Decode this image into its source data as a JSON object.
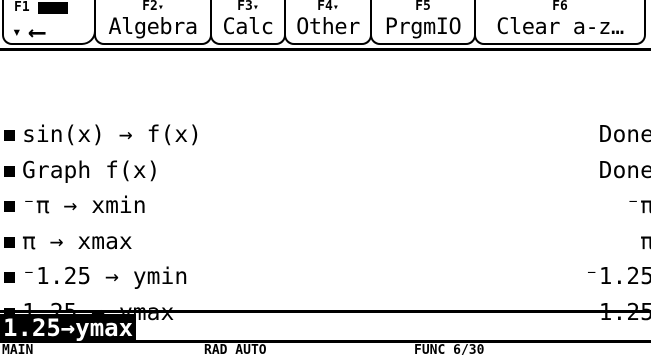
{
  "toolbar": {
    "tabs": [
      {
        "key": "F1",
        "label": ""
      },
      {
        "key": "F2",
        "label": "Algebra"
      },
      {
        "key": "F3",
        "label": "Calc"
      },
      {
        "key": "F4",
        "label": "Other"
      },
      {
        "key": "F5",
        "label": "PrgmIO"
      },
      {
        "key": "F6",
        "label": "Clear a-z…"
      }
    ]
  },
  "history": [
    {
      "expr": "sin(x) → f(x)",
      "result": "Done"
    },
    {
      "expr": "Graph  f(x)",
      "result": "Done"
    },
    {
      "expr": "⁻π → xmin",
      "result": "⁻π"
    },
    {
      "expr": "π → xmax",
      "result": "π"
    },
    {
      "expr": "⁻1.25 → ymin",
      "result": "⁻1.25"
    },
    {
      "expr": "1.25 → ymax",
      "result": "1.25"
    }
  ],
  "entry_line": "1.25→ymax",
  "status": {
    "mode": "MAIN",
    "angle_mode": "RAD AUTO",
    "graph_info": "FUNC 6/30"
  }
}
